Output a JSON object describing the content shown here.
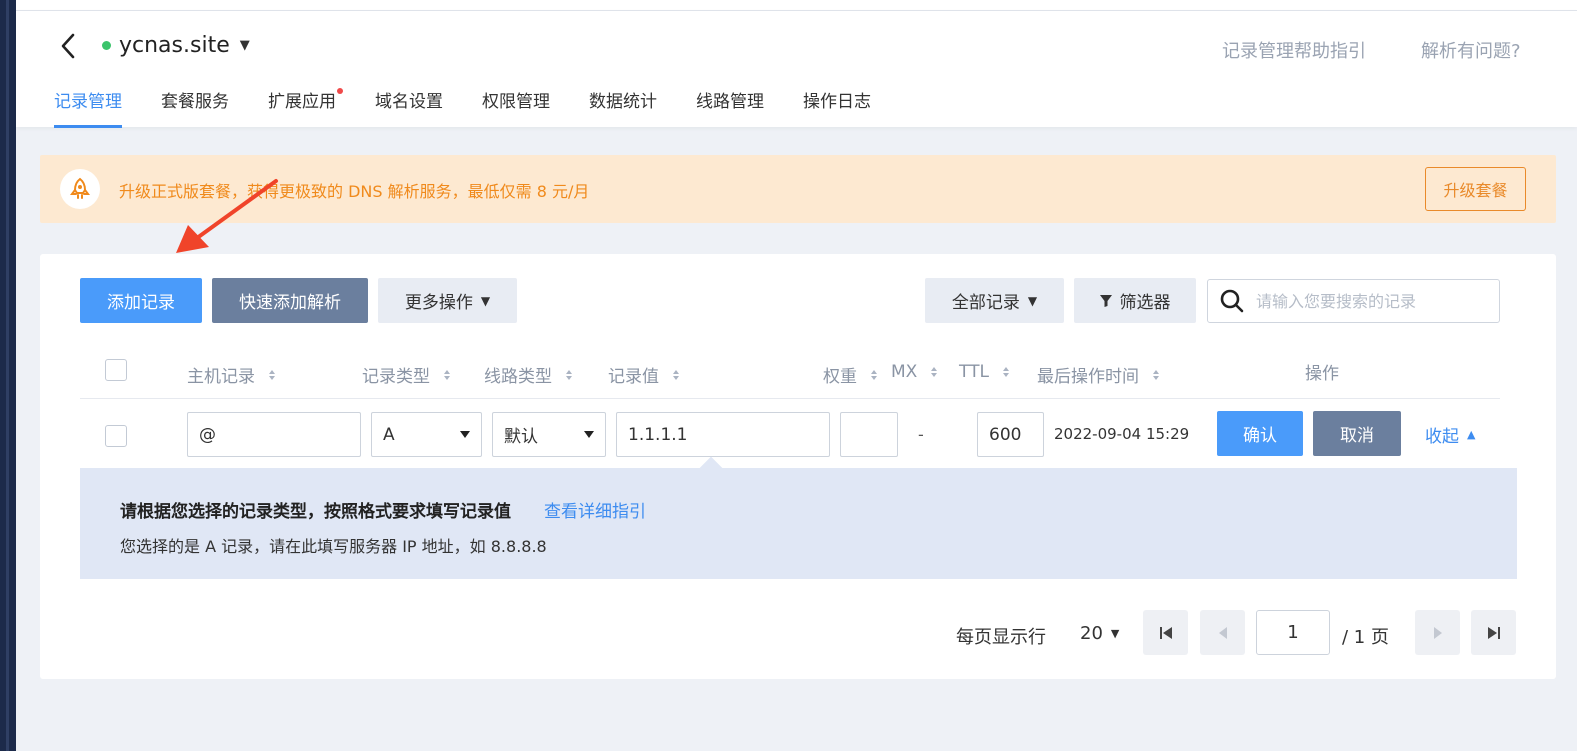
{
  "header": {
    "site_name": "ycnas.site",
    "help_link": "记录管理帮助指引",
    "problem_link": "解析有问题?",
    "tabs": [
      {
        "label": "记录管理"
      },
      {
        "label": "套餐服务"
      },
      {
        "label": "扩展应用"
      },
      {
        "label": "域名设置"
      },
      {
        "label": "权限管理"
      },
      {
        "label": "数据统计"
      },
      {
        "label": "线路管理"
      },
      {
        "label": "操作日志"
      }
    ]
  },
  "banner": {
    "text": "升级正式版套餐，获得更极致的 DNS 解析服务，最低仅需 8 元/月",
    "button": "升级套餐"
  },
  "toolbar": {
    "add_record": "添加记录",
    "quick_add": "快速添加解析",
    "more_ops": "更多操作",
    "all_records": "全部记录",
    "filter": "筛选器",
    "search_placeholder": "请输入您要搜索的记录"
  },
  "table": {
    "columns": {
      "host": "主机记录",
      "type": "记录类型",
      "line": "线路类型",
      "value": "记录值",
      "weight": "权重",
      "mx": "MX",
      "ttl": "TTL",
      "last_time": "最后操作时间",
      "ops": "操作"
    },
    "edit_row": {
      "host": "@",
      "type": "A",
      "line": "默认",
      "value": "1.1.1.1",
      "weight": "",
      "mx": "-",
      "ttl": "600",
      "last_time": "2022-09-04 15:29",
      "confirm": "确认",
      "cancel": "取消",
      "collapse": "收起"
    }
  },
  "hint": {
    "title": "请根据您选择的记录类型，按照格式要求填写记录值",
    "link": "查看详细指引",
    "body": "您选择的是 A 记录，请在此填写服务器 IP 地址，如 8.8.8.8"
  },
  "pagination": {
    "rows_label": "每页显示行",
    "rows_per_page": "20",
    "current_page": "1",
    "total_pages": "/ 1 页"
  },
  "colors": {
    "primary": "#4a9bfa",
    "accent_orange": "#f08a1c",
    "annotation_arrow": "#f0442a"
  }
}
